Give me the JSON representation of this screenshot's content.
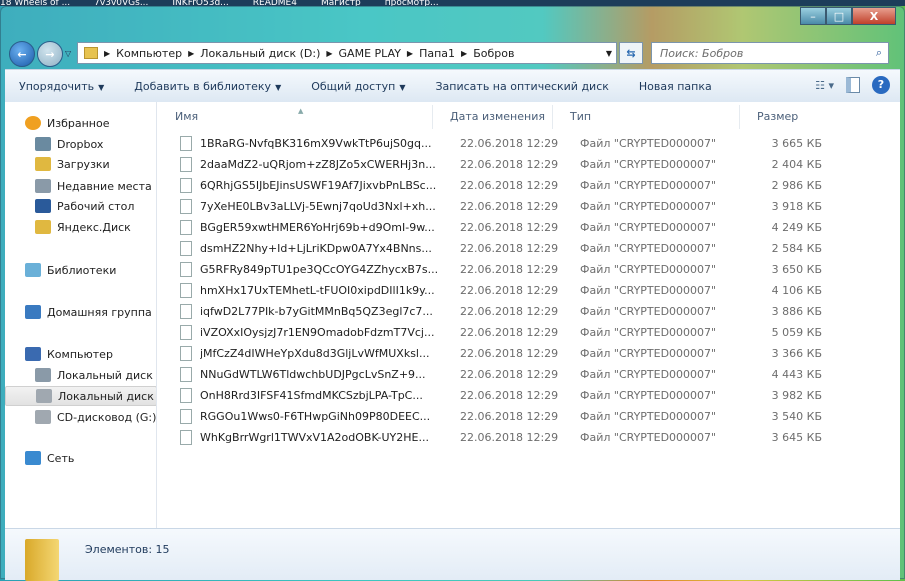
{
  "taskbar": [
    "18 Wheels of ...",
    "7v3v0VGs...",
    "INKFrO53d...",
    "README4",
    "Магистр",
    "просмотр..."
  ],
  "window": {
    "minimize": "–",
    "maximize": "□",
    "close": "X"
  },
  "nav": {
    "breadcrumbs": [
      "Компьютер",
      "Локальный диск (D:)",
      "GAME PLAY",
      "Папа1",
      "Бобров"
    ],
    "search_placeholder": "Поиск: Бобров"
  },
  "toolbar": {
    "organize": "Упорядочить",
    "add_library": "Добавить в библиотеку",
    "share": "Общий доступ",
    "burn": "Записать на оптический диск",
    "new_folder": "Новая папка"
  },
  "sidebar": [
    {
      "label": "Избранное",
      "icon": "star-icon",
      "color": "#f0a020"
    },
    {
      "label": "Dropbox",
      "icon": "dropbox-icon",
      "color": "#6a8aa0"
    },
    {
      "label": "Загрузки",
      "icon": "downloads-folder-icon",
      "color": "#e0b840"
    },
    {
      "label": "Недавние места",
      "icon": "recent-places-icon",
      "color": "#8a9aa8"
    },
    {
      "label": "Рабочий стол",
      "icon": "desktop-icon",
      "color": "#2a5a9a"
    },
    {
      "label": "Яндекс.Диск",
      "icon": "folder-icon",
      "color": "#e0b840"
    },
    {
      "label": "Библиотеки",
      "icon": "libraries-icon",
      "color": "#6ab0d8"
    },
    {
      "label": "Домашняя группа",
      "icon": "homegroup-icon",
      "color": "#3a7ac0"
    },
    {
      "label": "Компьютер",
      "icon": "computer-icon",
      "color": "#3a6ab0"
    },
    {
      "label": "Локальный диск (C:)",
      "icon": "system-drive-icon",
      "color": "#8a9aa8"
    },
    {
      "label": "Локальный диск (D:)",
      "icon": "drive-icon",
      "color": "#a0a8b0"
    },
    {
      "label": "CD-дисковод (G:)",
      "icon": "cd-drive-icon",
      "color": "#a0a8b0"
    },
    {
      "label": "Сеть",
      "icon": "network-icon",
      "color": "#3a8ad0"
    }
  ],
  "columns": {
    "name": "Имя",
    "date": "Дата изменения",
    "type": "Тип",
    "size": "Размер"
  },
  "files": [
    {
      "name": "1BRaRG-NvfqBK316mX9VwkTtP6ujS0gq...",
      "date": "22.06.2018 12:29",
      "type": "Файл \"CRYPTED000007\"",
      "size": "3 665 КБ"
    },
    {
      "name": "2daaMdZ2-uQRjom+zZ8JZo5xCWERHj3n...",
      "date": "22.06.2018 12:29",
      "type": "Файл \"CRYPTED000007\"",
      "size": "2 404 КБ"
    },
    {
      "name": "6QRhjGS5IJbEJinsUSWF19Af7JixvbPnLBSc...",
      "date": "22.06.2018 12:29",
      "type": "Файл \"CRYPTED000007\"",
      "size": "2 986 КБ"
    },
    {
      "name": "7yXeHE0LBv3aLLVj-5Ewnj7qoUd3Nxl+xh...",
      "date": "22.06.2018 12:29",
      "type": "Файл \"CRYPTED000007\"",
      "size": "3 918 КБ"
    },
    {
      "name": "BGgER59xwtHMER6YoHrj69b+d9OmI-9w...",
      "date": "22.06.2018 12:29",
      "type": "Файл \"CRYPTED000007\"",
      "size": "4 249 КБ"
    },
    {
      "name": "dsmHZ2Nhy+Id+LjLriKDpw0A7Yx4BNns...",
      "date": "22.06.2018 12:29",
      "type": "Файл \"CRYPTED000007\"",
      "size": "2 584 КБ"
    },
    {
      "name": "G5RFRy849pTU1pe3QCcOYG4ZZhycxB7s...",
      "date": "22.06.2018 12:29",
      "type": "Файл \"CRYPTED000007\"",
      "size": "3 650 КБ"
    },
    {
      "name": "hmXHx17UxTEMhetL-tFUOI0xipdDIlI1k9y...",
      "date": "22.06.2018 12:29",
      "type": "Файл \"CRYPTED000007\"",
      "size": "4 106 КБ"
    },
    {
      "name": "iqfwD2L77PIk-b7yGitMMnBq5QZ3egl7c7...",
      "date": "22.06.2018 12:29",
      "type": "Файл \"CRYPTED000007\"",
      "size": "3 886 КБ"
    },
    {
      "name": "iVZOXxIOysjzJ7r1EN9OmadobFdzmT7Vcj...",
      "date": "22.06.2018 12:29",
      "type": "Файл \"CRYPTED000007\"",
      "size": "5 059 КБ"
    },
    {
      "name": "jMfCzZ4dIWHeYpXdu8d3GljLvWfMUXksl...",
      "date": "22.06.2018 12:29",
      "type": "Файл \"CRYPTED000007\"",
      "size": "3 366 КБ"
    },
    {
      "name": "NNuGdWTLW6TldwchbUDJPgcLvSnZ+9...",
      "date": "22.06.2018 12:29",
      "type": "Файл \"CRYPTED000007\"",
      "size": "4 443 КБ"
    },
    {
      "name": "OnH8Rrd3IFSF41SfmdMKCSzbjLPA-TpC...",
      "date": "22.06.2018 12:29",
      "type": "Файл \"CRYPTED000007\"",
      "size": "3 982 КБ"
    },
    {
      "name": "RGGOu1Wws0-F6THwpGiNh09P80DEEC...",
      "date": "22.06.2018 12:29",
      "type": "Файл \"CRYPTED000007\"",
      "size": "3 540 КБ"
    },
    {
      "name": "WhKgBrrWgrl1TWVxV1A2odOBK-UY2HE...",
      "date": "22.06.2018 12:29",
      "type": "Файл \"CRYPTED000007\"",
      "size": "3 645 КБ"
    }
  ],
  "status": {
    "count": "Элементов: 15"
  }
}
